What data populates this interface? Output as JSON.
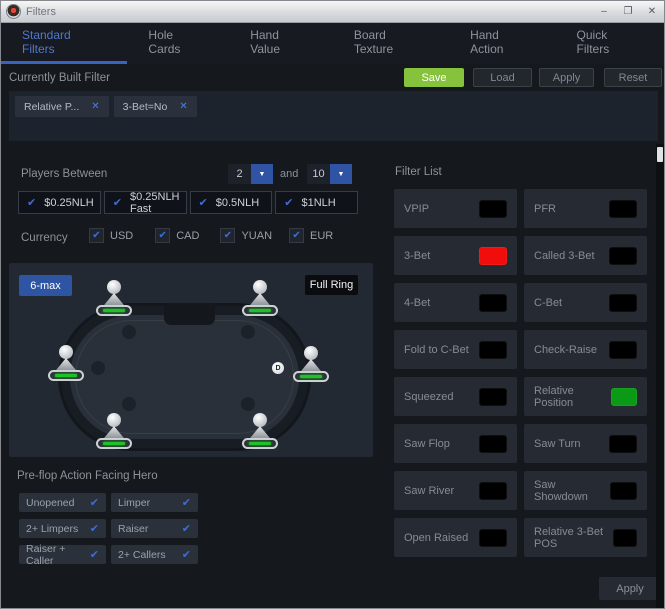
{
  "window": {
    "title": "Filters"
  },
  "icons": {
    "check": "✔",
    "close": "✕",
    "dropdown": "▼",
    "minimize": "–",
    "maximize": "❐"
  },
  "tabs": [
    {
      "label": "Standard Filters",
      "active": true
    },
    {
      "label": "Hole Cards",
      "active": false
    },
    {
      "label": "Hand Value",
      "active": false
    },
    {
      "label": "Board Texture",
      "active": false
    },
    {
      "label": "Hand Action",
      "active": false
    },
    {
      "label": "Quick Filters",
      "active": false
    }
  ],
  "current_filter": {
    "title": "Currently Built Filter",
    "save": "Save",
    "load": "Load",
    "apply": "Apply",
    "reset": "Reset",
    "chips": [
      {
        "label": "Relative P..."
      },
      {
        "label": "3-Bet=No"
      }
    ]
  },
  "players": {
    "label": "Players Between",
    "from": "2",
    "and": "and",
    "to": "10"
  },
  "stakes": [
    {
      "label": "$0.25NLH",
      "checked": true
    },
    {
      "label": "$0.25NLH Fast",
      "checked": true
    },
    {
      "label": "$0.5NLH",
      "checked": true
    },
    {
      "label": "$1NLH",
      "checked": true
    }
  ],
  "currency": {
    "label": "Currency",
    "options": [
      {
        "label": "USD",
        "checked": true
      },
      {
        "label": "CAD",
        "checked": true
      },
      {
        "label": "YUAN",
        "checked": true
      },
      {
        "label": "EUR",
        "checked": true
      }
    ]
  },
  "table": {
    "six_max": "6-max",
    "full_ring": "Full Ring",
    "dealer_button": "D",
    "seats": 6
  },
  "preflop": {
    "title": "Pre-flop Action Facing Hero",
    "options": [
      {
        "label": "Unopened",
        "checked": true
      },
      {
        "label": "Limper",
        "checked": true
      },
      {
        "label": "2+ Limpers",
        "checked": true
      },
      {
        "label": "Raiser",
        "checked": true
      },
      {
        "label": "Raiser + Caller",
        "checked": true
      },
      {
        "label": "2+ Callers",
        "checked": true
      }
    ]
  },
  "filter_list": {
    "title": "Filter List",
    "items": [
      {
        "label": "VPIP",
        "color": "#000000"
      },
      {
        "label": "PFR",
        "color": "#000000"
      },
      {
        "label": "3-Bet",
        "color": "#f20d0d"
      },
      {
        "label": "Called 3-Bet",
        "color": "#000000"
      },
      {
        "label": "4-Bet",
        "color": "#000000"
      },
      {
        "label": "C-Bet",
        "color": "#000000"
      },
      {
        "label": "Fold to C-Bet",
        "color": "#000000"
      },
      {
        "label": "Check-Raise",
        "color": "#000000"
      },
      {
        "label": "Squeezed",
        "color": "#000000"
      },
      {
        "label": "Relative Position",
        "color": "#0b9a16"
      },
      {
        "label": "Saw Flop",
        "color": "#000000"
      },
      {
        "label": "Saw Turn",
        "color": "#000000"
      },
      {
        "label": "Saw River",
        "color": "#000000"
      },
      {
        "label": "Saw Showdown",
        "color": "#000000"
      },
      {
        "label": "Open Raised",
        "color": "#000000"
      },
      {
        "label": "Relative 3-Bet POS",
        "color": "#000000"
      }
    ],
    "apply": "Apply"
  },
  "colors": {
    "accent_blue": "#2f54a5",
    "check_blue": "#3f6cd6",
    "tab_active_blue": "#4e79d0",
    "save_green": "#86c23c",
    "toggle_red": "#f20d0d",
    "toggle_green": "#0b9a16",
    "seat_bar_green": "#1fc226"
  }
}
